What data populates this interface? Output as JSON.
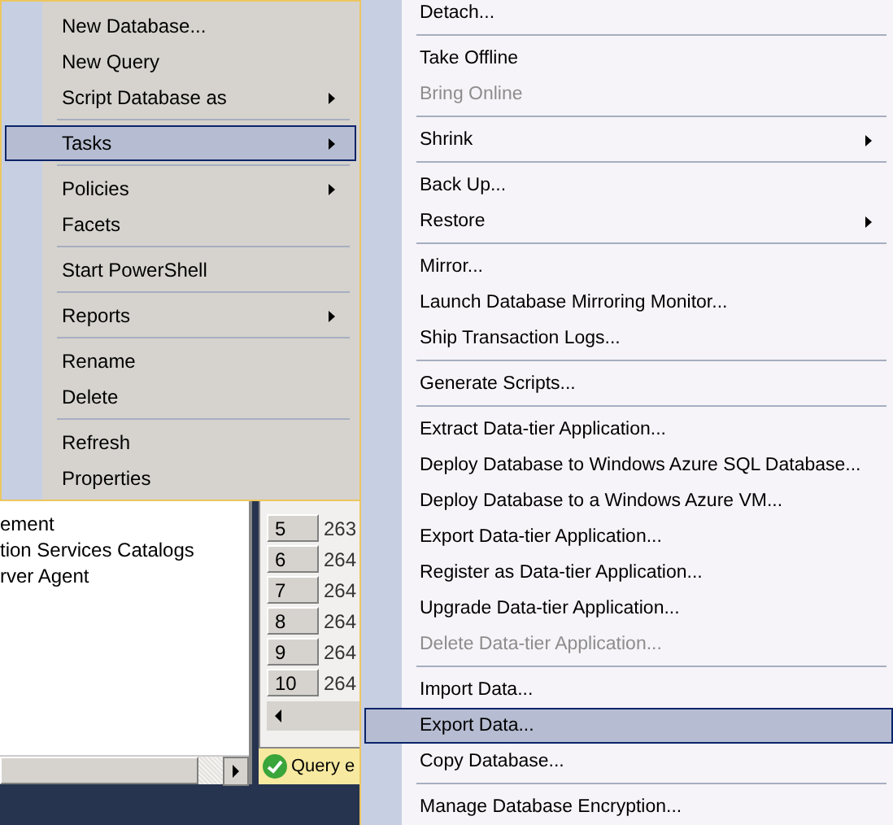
{
  "tree": {
    "items": [
      {
        "label": "ement"
      },
      {
        "label": "tion Services Catalogs"
      },
      {
        "label": "rver Agent"
      }
    ]
  },
  "results": {
    "rows": [
      {
        "header": "5",
        "value": "263"
      },
      {
        "header": "6",
        "value": "264"
      },
      {
        "header": "7",
        "value": "264"
      },
      {
        "header": "8",
        "value": "264"
      },
      {
        "header": "9",
        "value": "264"
      },
      {
        "header": "10",
        "value": "264"
      }
    ],
    "status": "Query e"
  },
  "context_menu": {
    "items": [
      {
        "kind": "item",
        "label": "New Database...",
        "submenu": false,
        "selected": false,
        "disabled": false
      },
      {
        "kind": "item",
        "label": "New Query",
        "submenu": false,
        "selected": false,
        "disabled": false
      },
      {
        "kind": "item",
        "label": "Script Database as",
        "submenu": true,
        "selected": false,
        "disabled": false
      },
      {
        "kind": "separator"
      },
      {
        "kind": "item",
        "label": "Tasks",
        "submenu": true,
        "selected": true,
        "disabled": false
      },
      {
        "kind": "separator"
      },
      {
        "kind": "item",
        "label": "Policies",
        "submenu": true,
        "selected": false,
        "disabled": false
      },
      {
        "kind": "item",
        "label": "Facets",
        "submenu": false,
        "selected": false,
        "disabled": false
      },
      {
        "kind": "separator"
      },
      {
        "kind": "item",
        "label": "Start PowerShell",
        "submenu": false,
        "selected": false,
        "disabled": false
      },
      {
        "kind": "separator"
      },
      {
        "kind": "item",
        "label": "Reports",
        "submenu": true,
        "selected": false,
        "disabled": false
      },
      {
        "kind": "separator"
      },
      {
        "kind": "item",
        "label": "Rename",
        "submenu": false,
        "selected": false,
        "disabled": false
      },
      {
        "kind": "item",
        "label": "Delete",
        "submenu": false,
        "selected": false,
        "disabled": false
      },
      {
        "kind": "separator"
      },
      {
        "kind": "item",
        "label": "Refresh",
        "submenu": false,
        "selected": false,
        "disabled": false
      },
      {
        "kind": "item",
        "label": "Properties",
        "submenu": false,
        "selected": false,
        "disabled": false
      }
    ]
  },
  "tasks_submenu": {
    "items": [
      {
        "kind": "item",
        "label": "Detach...",
        "submenu": false,
        "selected": false,
        "disabled": false
      },
      {
        "kind": "separator"
      },
      {
        "kind": "item",
        "label": "Take Offline",
        "submenu": false,
        "selected": false,
        "disabled": false
      },
      {
        "kind": "item",
        "label": "Bring Online",
        "submenu": false,
        "selected": false,
        "disabled": true
      },
      {
        "kind": "separator"
      },
      {
        "kind": "item",
        "label": "Shrink",
        "submenu": true,
        "selected": false,
        "disabled": false
      },
      {
        "kind": "separator"
      },
      {
        "kind": "item",
        "label": "Back Up...",
        "submenu": false,
        "selected": false,
        "disabled": false
      },
      {
        "kind": "item",
        "label": "Restore",
        "submenu": true,
        "selected": false,
        "disabled": false
      },
      {
        "kind": "separator"
      },
      {
        "kind": "item",
        "label": "Mirror...",
        "submenu": false,
        "selected": false,
        "disabled": false
      },
      {
        "kind": "item",
        "label": "Launch Database Mirroring Monitor...",
        "submenu": false,
        "selected": false,
        "disabled": false
      },
      {
        "kind": "item",
        "label": "Ship Transaction Logs...",
        "submenu": false,
        "selected": false,
        "disabled": false
      },
      {
        "kind": "separator"
      },
      {
        "kind": "item",
        "label": "Generate Scripts...",
        "submenu": false,
        "selected": false,
        "disabled": false
      },
      {
        "kind": "separator"
      },
      {
        "kind": "item",
        "label": "Extract Data-tier Application...",
        "submenu": false,
        "selected": false,
        "disabled": false
      },
      {
        "kind": "item",
        "label": "Deploy Database to Windows Azure SQL Database...",
        "submenu": false,
        "selected": false,
        "disabled": false
      },
      {
        "kind": "item",
        "label": "Deploy Database to a Windows Azure VM...",
        "submenu": false,
        "selected": false,
        "disabled": false
      },
      {
        "kind": "item",
        "label": "Export Data-tier Application...",
        "submenu": false,
        "selected": false,
        "disabled": false
      },
      {
        "kind": "item",
        "label": "Register as Data-tier Application...",
        "submenu": false,
        "selected": false,
        "disabled": false
      },
      {
        "kind": "item",
        "label": "Upgrade Data-tier Application...",
        "submenu": false,
        "selected": false,
        "disabled": false
      },
      {
        "kind": "item",
        "label": "Delete Data-tier Application...",
        "submenu": false,
        "selected": false,
        "disabled": true
      },
      {
        "kind": "separator"
      },
      {
        "kind": "item",
        "label": "Import Data...",
        "submenu": false,
        "selected": false,
        "disabled": false
      },
      {
        "kind": "item",
        "label": "Export Data...",
        "submenu": false,
        "selected": true,
        "disabled": false
      },
      {
        "kind": "item",
        "label": "Copy Database...",
        "submenu": false,
        "selected": false,
        "disabled": false
      },
      {
        "kind": "separator"
      },
      {
        "kind": "item",
        "label": "Manage Database Encryption...",
        "submenu": false,
        "selected": false,
        "disabled": false
      }
    ]
  }
}
